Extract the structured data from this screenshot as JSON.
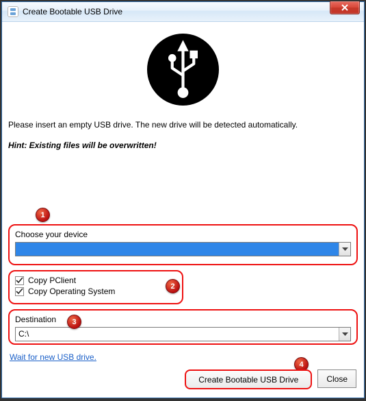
{
  "window": {
    "title": "Create Bootable USB Drive"
  },
  "intro_text": "Please insert an empty USB drive. The new drive will be detected automatically.",
  "hint_text": "Hint: Existing files will be overwritten!",
  "device": {
    "label": "Choose your device",
    "value": ""
  },
  "options": {
    "copy_pclient": {
      "label": "Copy PClient",
      "checked": true
    },
    "copy_os": {
      "label": "Copy Operating System",
      "checked": true
    }
  },
  "destination": {
    "label": "Destination",
    "value": "C:\\"
  },
  "link_text": "Wait for new USB drive.",
  "buttons": {
    "create": "Create Bootable USB Drive",
    "close": "Close"
  },
  "badges": {
    "n1": "1",
    "n2": "2",
    "n3": "3",
    "n4": "4"
  }
}
